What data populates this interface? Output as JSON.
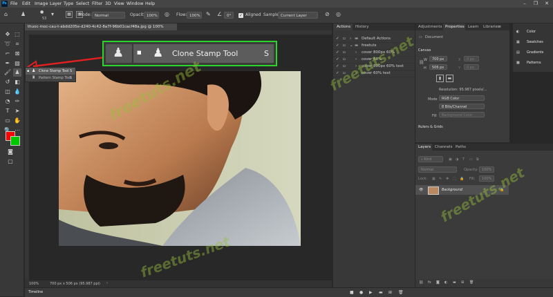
{
  "app": {
    "logo": "Ps",
    "colors": {
      "accent": "#2bd52b",
      "arrow": "#e02020",
      "fg_color": "#ff0000",
      "bg_color": "#00c800"
    }
  },
  "menu": [
    "File",
    "Edit",
    "Image",
    "Layer",
    "Type",
    "Select",
    "Filter",
    "3D",
    "View",
    "Window",
    "Help"
  ],
  "options_bar": {
    "brush_size": "53",
    "mode_label": "Mode:",
    "mode_value": "Normal",
    "opacity_label": "Opacity:",
    "opacity_value": "100%",
    "flow_label": "Flow:",
    "flow_value": "100%",
    "angle_value": "0°",
    "aligned_label": "Aligned",
    "sample_label": "Sample:",
    "sample_value": "Current Layer"
  },
  "document": {
    "tab_title": "thuoc-moc-cau-t-abdd205e-d240-4c42-8a7f-96b01cacf48a.jpg @ 100% (RGB/8#) *",
    "zoom": "100%",
    "status": "700 px x 506 px (95.987 ppi)"
  },
  "tool_flyout": [
    {
      "label": "Clone Stamp Tool",
      "shortcut": "S"
    },
    {
      "label": "Pattern Stamp Tool",
      "shortcut": "S"
    }
  ],
  "callout": {
    "label": "Clone Stamp Tool",
    "shortcut": "S"
  },
  "actions_panel": {
    "tabs": [
      "Actions",
      "History"
    ],
    "rows": [
      "Default Actions",
      "freetuts",
      "cover 800px 60%",
      "cover 60%",
      "cover 800px 60% text",
      "cover 60% text"
    ]
  },
  "properties_panel": {
    "tabs": [
      "Adjustments",
      "Properties",
      "Learn",
      "Libraries"
    ],
    "doc_label": "Document",
    "canvas_header": "Canvas",
    "w_label": "W",
    "w_value": "700 px",
    "h_label": "H",
    "h_value": "506 px",
    "x_value": "0 px",
    "y_value": "0 px",
    "resolution": "Resolution: 95.987 pixels/...",
    "mode_label": "Mode",
    "mode_value": "RGB Color",
    "depth_value": "8 Bits/Channel",
    "fill_label": "Fill",
    "fill_value": "Background Color",
    "rulers_header": "Rulers & Grids"
  },
  "right_strip": {
    "items": [
      "Color",
      "Swatches",
      "Gradients",
      "Patterns"
    ]
  },
  "layers_panel": {
    "tabs": [
      "Layers",
      "Channels",
      "Paths"
    ],
    "kind": "Kind",
    "blend": "Normal",
    "opacity_label": "Opacity:",
    "opacity_value": "100%",
    "lock_label": "Lock:",
    "fill_label": "Fill:",
    "fill_value": "100%",
    "layer_name": "Background"
  },
  "timeline": {
    "label": "Timeline"
  },
  "watermarks": [
    "freetuts.net",
    "freetuts.net",
    "freetuts.net",
    "freetuts.net"
  ]
}
